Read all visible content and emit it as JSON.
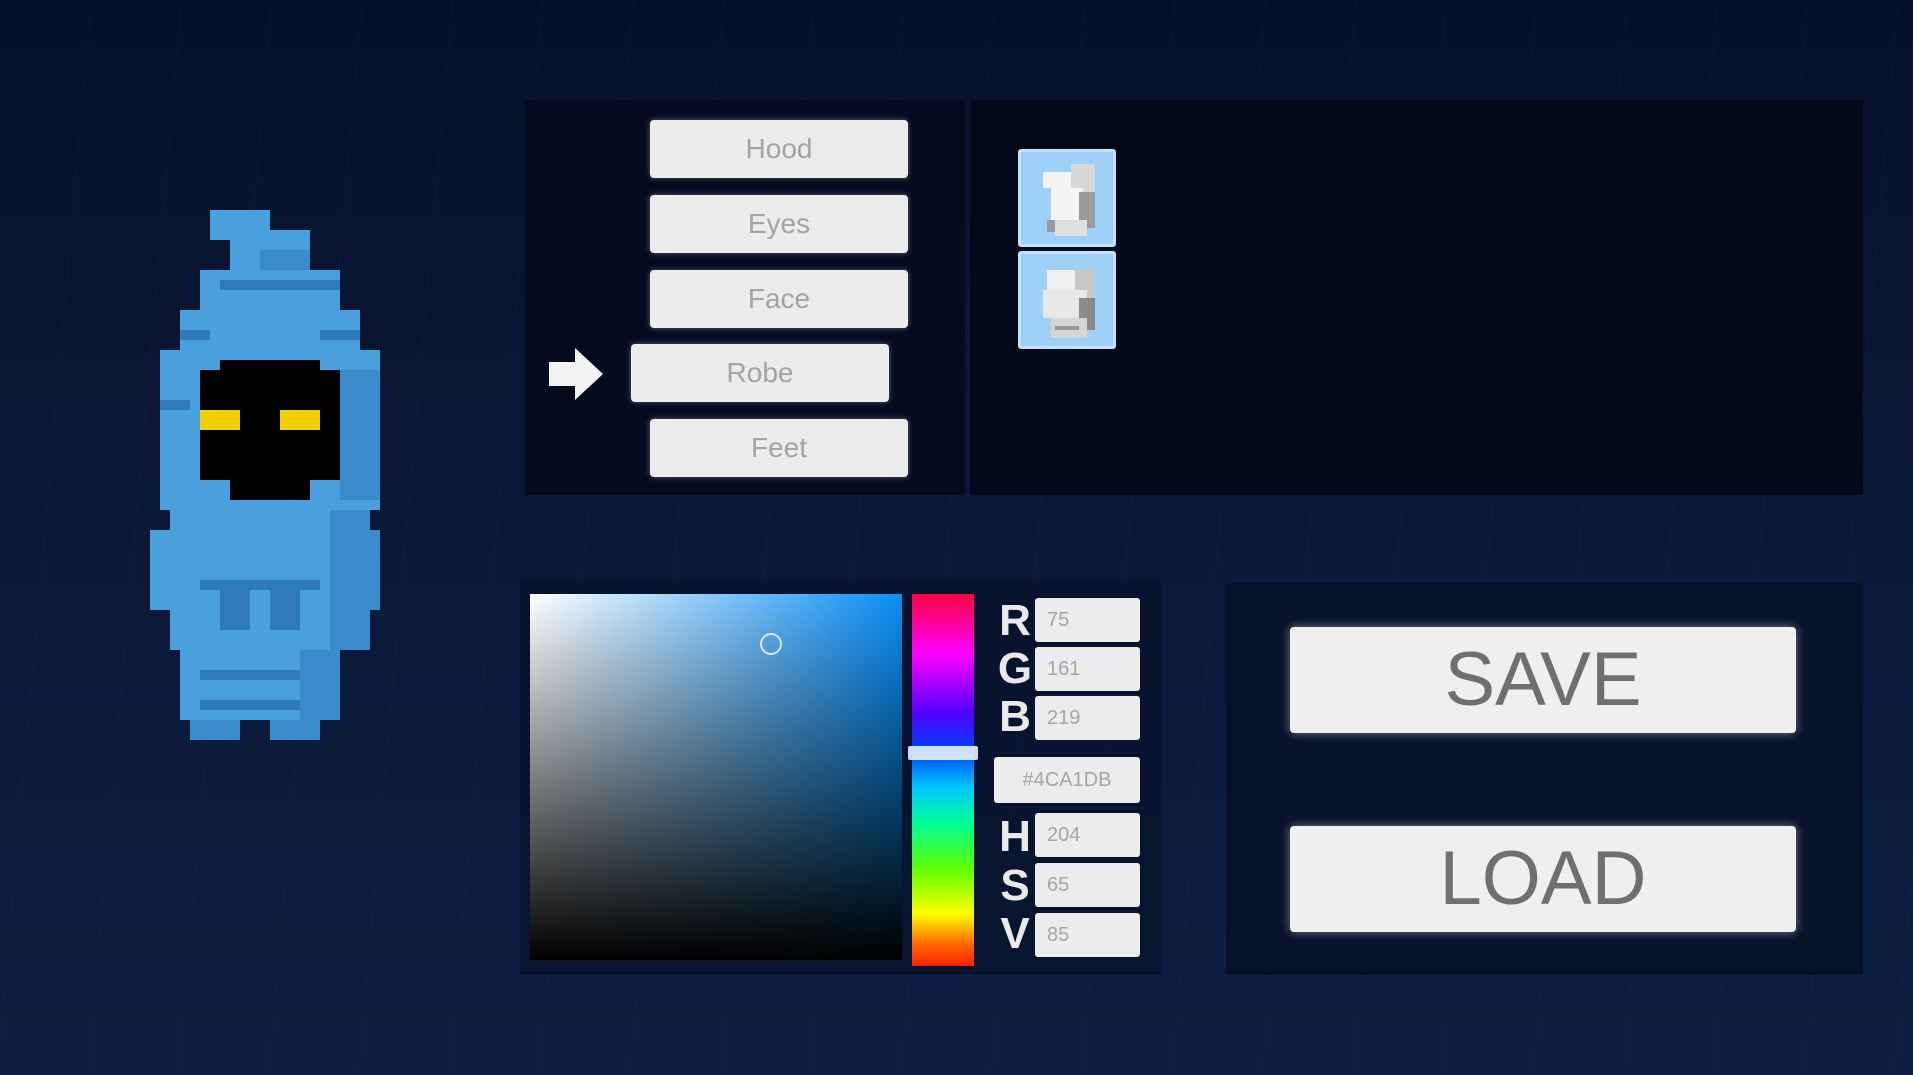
{
  "parts_menu": {
    "items": [
      "Hood",
      "Eyes",
      "Face",
      "Robe",
      "Feet"
    ],
    "selected": "Robe"
  },
  "variants": {
    "count": 2
  },
  "color_picker": {
    "r_label": "R",
    "g_label": "G",
    "b_label": "B",
    "h_label": "H",
    "s_label": "S",
    "v_label": "V",
    "r_value": "75",
    "g_value": "161",
    "b_value": "219",
    "hex_value": "#4CA1DB",
    "h_value": "204",
    "s_value": "65",
    "v_value": "85",
    "current_color": "#4CA1DB"
  },
  "actions": {
    "save_label": "SAVE",
    "load_label": "LOAD"
  },
  "colors": {
    "character_light": "#4aa0dc",
    "character_dark": "#2a73b0",
    "eyes": "#f0d000",
    "panel_bg": "#050b1d"
  }
}
